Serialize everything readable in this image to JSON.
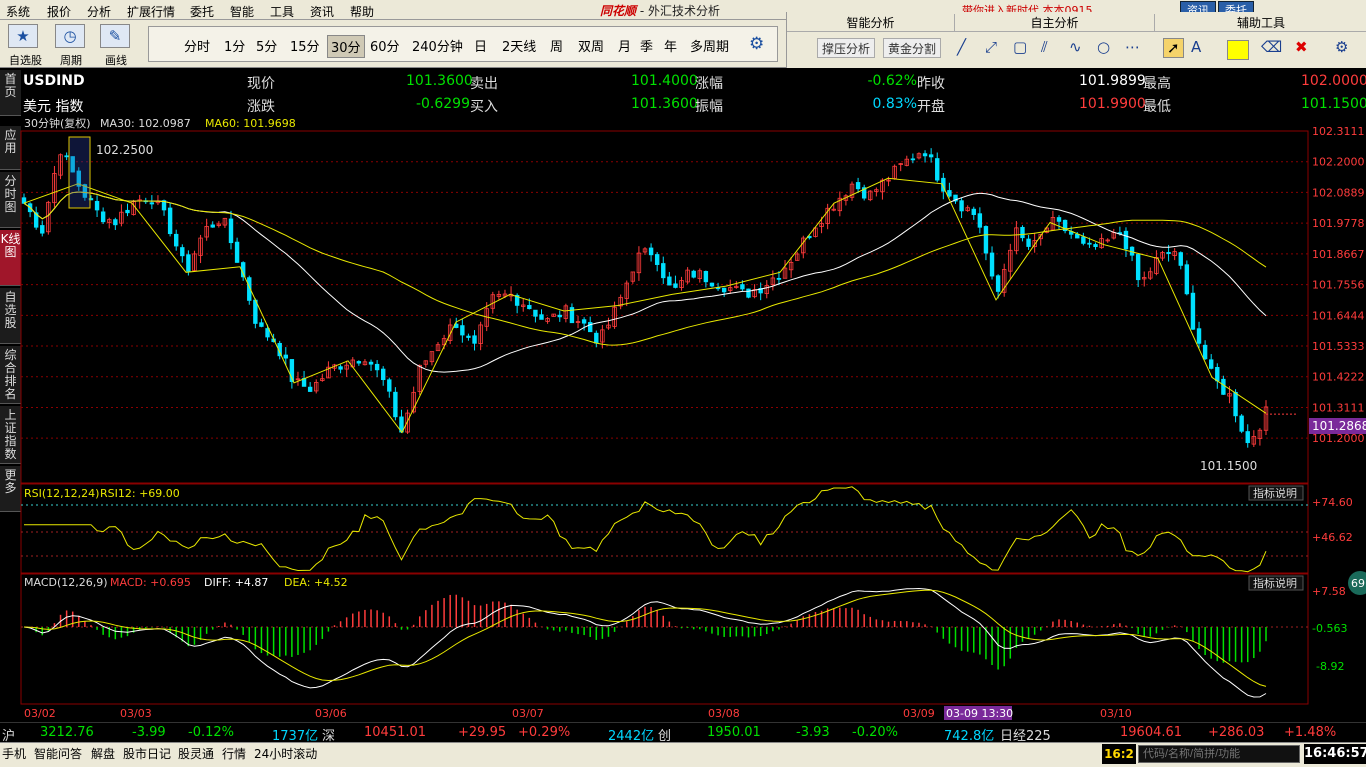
{
  "menu": [
    "系统",
    "报价",
    "分析",
    "扩展行情",
    "委托",
    "智能",
    "工具",
    "资讯",
    "帮助"
  ],
  "app": {
    "brand": "同花顺",
    "title": " - 外汇技术分析",
    "tip": "带你进入新时代  本本0915",
    "btn_info": "资讯",
    "btn_trade": "委托"
  },
  "toolbar": {
    "left_labels": [
      "自选股",
      "周期",
      "画线"
    ],
    "periods": [
      "分时",
      "1分",
      "5分",
      "15分",
      "30分",
      "60分",
      "240分钟",
      "日",
      "2天线",
      "周",
      "双周",
      "月",
      "季",
      "年",
      "多周期"
    ],
    "active_period": "30分"
  },
  "panels": {
    "headers": [
      "智能分析",
      "自主分析",
      "辅助工具"
    ],
    "buttons": [
      "撑压分析",
      "黄金分割"
    ]
  },
  "side_tabs": [
    "首页",
    "应用",
    "分时图",
    "K线图",
    "自选股",
    "综合排名",
    "上证指数",
    "更多"
  ],
  "quote": {
    "symbol": "USDIND",
    "name": "美元 指数",
    "row1": [
      {
        "label": "现价",
        "value": "101.3600"
      },
      {
        "label": "卖出",
        "value": "101.4000"
      },
      {
        "label": "涨幅",
        "value": "-0.62%"
      },
      {
        "label": "昨收",
        "value": "101.9899"
      },
      {
        "label": "最高",
        "value": "102.0000"
      }
    ],
    "row2": [
      {
        "label": "涨跌",
        "value": "-0.6299"
      },
      {
        "label": "买入",
        "value": "101.3600"
      },
      {
        "label": "振幅",
        "value": "0.83%"
      },
      {
        "label": "开盘",
        "value": "101.9900"
      },
      {
        "label": "最低",
        "value": "101.1500"
      }
    ]
  },
  "colors": {
    "up": "#ff3c3c",
    "down": "#00e0ff",
    "green": "#00e000",
    "yellow": "#e8e800",
    "white": "#ffffff",
    "grid": "#8a0000",
    "purple": "#7a2a9a"
  },
  "main_legend": {
    "period": "30分钟(复权)",
    "ma30": "MA30: 102.0987",
    "ma60": "MA60: 101.9698"
  },
  "rsi_legend": {
    "label": "RSI(12,12,24)",
    "value": "RSI12: +69.00",
    "ticks": [
      "+74.60",
      "+46.62"
    ],
    "explain": "指标说明"
  },
  "macd_legend": {
    "label": "MACD(12,26,9)",
    "macd": "MACD: +0.695",
    "diff": "DIFF: +4.87",
    "dea": "DEA: +4.52",
    "ticks": [
      "+7.58",
      "-0.563",
      "-8.92"
    ],
    "explain": "指标说明",
    "bubble": "69"
  },
  "price_axis": [
    "102.3111",
    "102.2000",
    "102.0889",
    "101.9778",
    "101.8667",
    "101.7556",
    "101.6444",
    "101.5333",
    "101.4222",
    "101.3111",
    "101.2000"
  ],
  "current_price_tag": "101.2868",
  "high_mark": "102.2500",
  "low_mark": "101.1500",
  "dates": [
    "03/02",
    "03/03",
    "03/06",
    "03/07",
    "03/08",
    "03/09",
    "03/10"
  ],
  "cursor_date": "03-09 13:30",
  "status": {
    "sh": {
      "name": "沪",
      "price": "3212.76",
      "chg": "-3.99",
      "pct": "-0.12%",
      "vol": "1737亿"
    },
    "sz": {
      "name": "深",
      "price": "10451.01",
      "chg": "+29.95",
      "pct": "+0.29%",
      "vol": "2442亿"
    },
    "cy": {
      "name": "创",
      "price": "1950.01",
      "chg": "-3.93",
      "pct": "-0.20%",
      "vol": "742.8亿"
    },
    "nk": {
      "name": "日经225",
      "price": "19604.61",
      "chg": "+286.03",
      "pct": "+1.48%"
    }
  },
  "taskbar": [
    "手机",
    "智能问答",
    "解盘",
    "股市日记",
    "股灵通",
    "行情",
    "24小时滚动"
  ],
  "search_placeholder": "代码/名称/简拼/功能",
  "clock": "16:46:57",
  "clock_small": "16:2",
  "chart_data": {
    "type": "candlestick",
    "symbol": "USDIND",
    "period": "30min",
    "ylim": [
      101.15,
      102.3111
    ],
    "high": 102.25,
    "low": 101.15,
    "last": 101.2868,
    "path_prices": [
      102.05,
      101.95,
      102.25,
      102.12,
      102.02,
      101.98,
      102.05,
      102.08,
      101.98,
      101.8,
      101.95,
      102.0,
      101.82,
      101.6,
      101.55,
      101.4,
      101.38,
      101.45,
      101.48,
      101.5,
      101.4,
      101.22,
      101.45,
      101.55,
      101.62,
      101.52,
      101.7,
      101.72,
      101.68,
      101.62,
      101.66,
      101.62,
      101.55,
      101.68,
      101.85,
      101.88,
      101.72,
      101.8,
      101.78,
      101.75,
      101.72,
      101.75,
      101.8,
      101.88,
      101.98,
      102.05,
      102.12,
      102.08,
      102.14,
      102.2,
      102.25,
      102.12,
      102.05,
      102.0,
      101.7,
      101.95,
      101.88,
      101.98,
      101.95,
      101.88,
      101.9,
      101.95,
      101.75,
      101.85,
      101.88,
      101.6,
      101.42,
      101.35,
      101.18,
      101.29
    ]
  }
}
